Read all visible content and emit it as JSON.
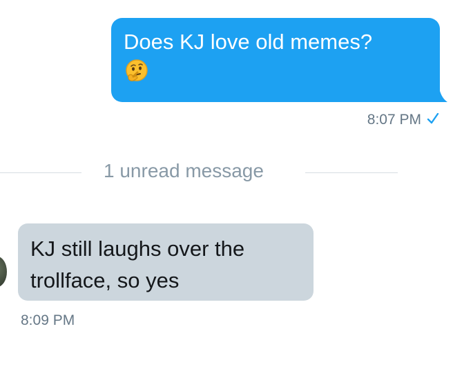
{
  "conversation": {
    "outgoing_message": {
      "text": "Does KJ love old memes?",
      "emoji_icon": "thinking-face-emoji",
      "time": "8:07 PM",
      "status_icon": "checkmark-icon",
      "bubble_color": "#1da1f2"
    },
    "divider": {
      "label": "1 unread message"
    },
    "incoming_message": {
      "text": "KJ still laughs over the trollface, so yes",
      "time": "8:09 PM",
      "bubble_color": "#ccd6dd"
    }
  }
}
